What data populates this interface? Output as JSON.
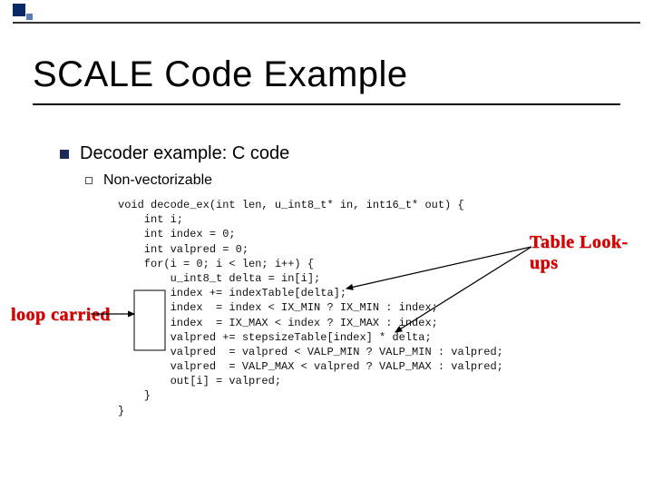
{
  "title": "SCALE Code Example",
  "bullet1": "Decoder example: C code",
  "bullet2": "Non-vectorizable",
  "annotations": {
    "left": "loop carried",
    "right": "Table Look-ups"
  },
  "code": "void decode_ex(int len, u_int8_t* in, int16_t* out) {\n    int i;\n    int index = 0;\n    int valpred = 0;\n    for(i = 0; i < len; i++) {\n        u_int8_t delta = in[i];\n        index += indexTable[delta];\n        index  = index < IX_MIN ? IX_MIN : index;\n        index  = IX_MAX < index ? IX_MAX : index;\n        valpred += stepsizeTable[index] * delta;\n        valpred  = valpred < VALP_MIN ? VALP_MIN : valpred;\n        valpred  = VALP_MAX < valpred ? VALP_MAX : valpred;\n        out[i] = valpred;\n    }\n}"
}
